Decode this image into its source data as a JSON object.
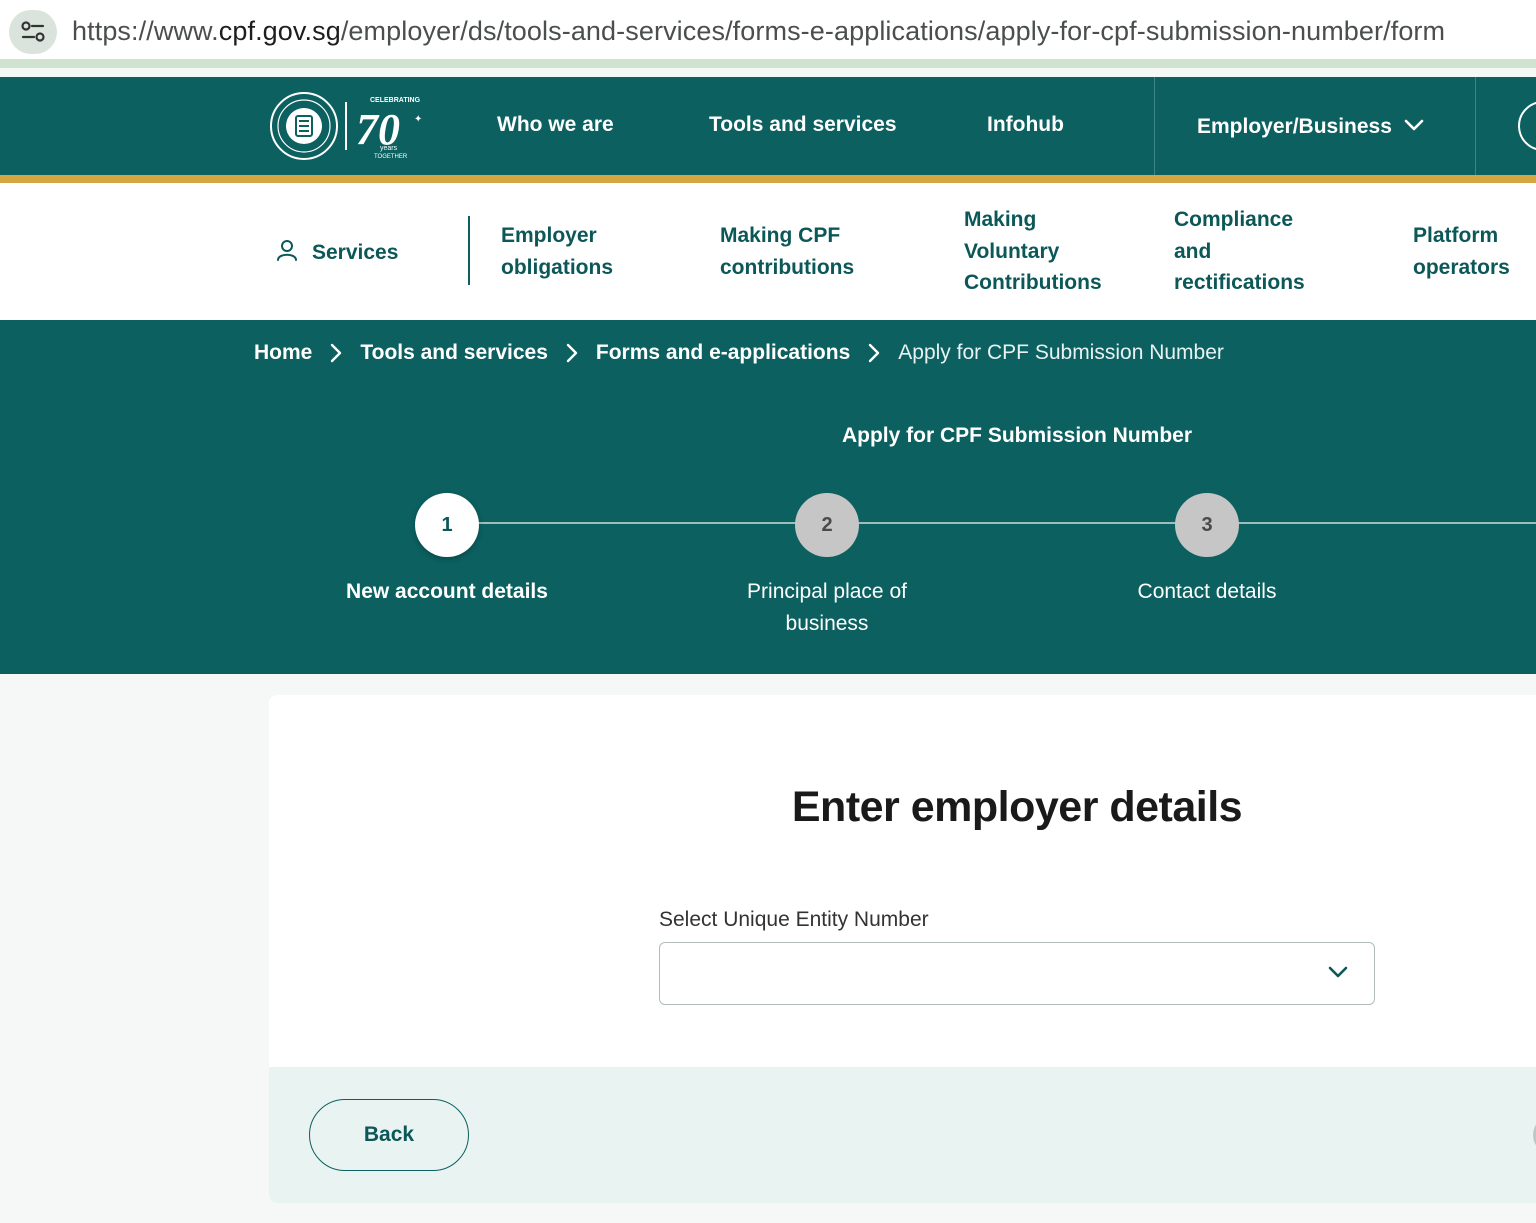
{
  "browser": {
    "url_prefix": "https://www.",
    "url_host": "cpf.gov.sg",
    "url_path": "/employer/ds/tools-and-services/forms-e-applications/apply-for-cpf-submission-number/form",
    "site_info_icon": "tune-icon"
  },
  "topnav": {
    "logo_text": "CELEBRATING 70 years TOGETHER",
    "items": [
      "Who we are",
      "Tools and services",
      "Infohub"
    ],
    "audience": "Employer/Business",
    "colors": {
      "background": "#0c6060",
      "accent_bar": "#d4a642"
    }
  },
  "subnav": {
    "services": "Services",
    "items": [
      [
        "Employer",
        "obligations"
      ],
      [
        "Making CPF",
        "contributions"
      ],
      [
        "Making",
        "Voluntary",
        "Contributions"
      ],
      [
        "Compliance",
        "and",
        "rectifications"
      ],
      [
        "Platform",
        "operators"
      ]
    ]
  },
  "breadcrumb": {
    "items": [
      "Home",
      "Tools and services",
      "Forms and e-applications"
    ],
    "current": "Apply for CPF Submission Number"
  },
  "form": {
    "title": "Apply for CPF Submission Number",
    "steps": [
      {
        "number": "1",
        "label": "New account details",
        "state": "active"
      },
      {
        "number": "2",
        "label": "Principal place of business",
        "state": "inactive"
      },
      {
        "number": "3",
        "label": "Contact details",
        "state": "inactive"
      }
    ],
    "heading": "Enter employer details",
    "uen_label": "Select Unique Entity Number",
    "uen_value": "",
    "back_button": "Back"
  }
}
